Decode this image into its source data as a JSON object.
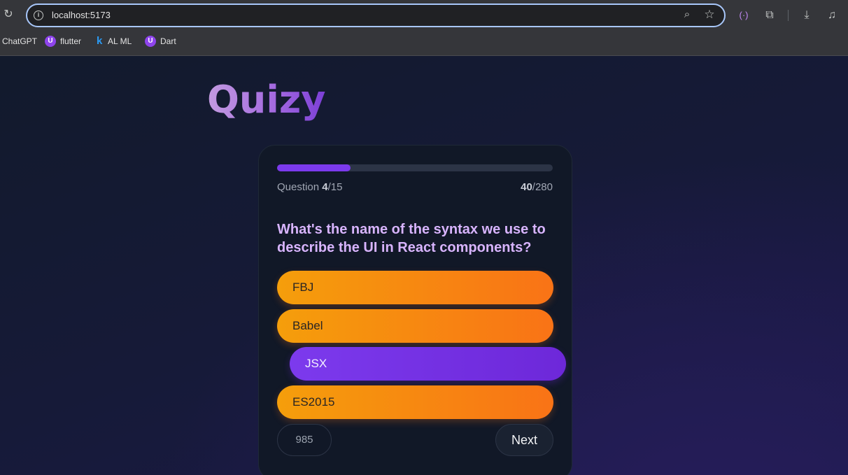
{
  "browser": {
    "url": "localhost:5173",
    "bookmarks": [
      {
        "label": "ChatGPT",
        "icon": "none"
      },
      {
        "label": "flutter",
        "icon": "u-badge-icon"
      },
      {
        "label": "AL ML",
        "icon": "k-icon"
      },
      {
        "label": "Dart",
        "icon": "u-badge-icon"
      }
    ]
  },
  "app": {
    "title": "Quizy"
  },
  "quiz": {
    "progress_fraction": 0.267,
    "question_label": "Question ",
    "question_current": "4",
    "question_total": "/15",
    "points_current": "40",
    "points_total": "/280",
    "question_text": "What's the name of the syntax we use to describe the UI in React components?",
    "options": [
      {
        "label": "FBJ",
        "selected": false
      },
      {
        "label": "Babel",
        "selected": false
      },
      {
        "label": "JSX",
        "selected": true
      },
      {
        "label": "ES2015",
        "selected": false
      }
    ],
    "timer": "985",
    "next_label": "Next"
  },
  "colors": {
    "accent": "#7c3aed",
    "option_start": "#f59e0b",
    "option_end": "#f97316",
    "question": "#d8b4fe"
  }
}
